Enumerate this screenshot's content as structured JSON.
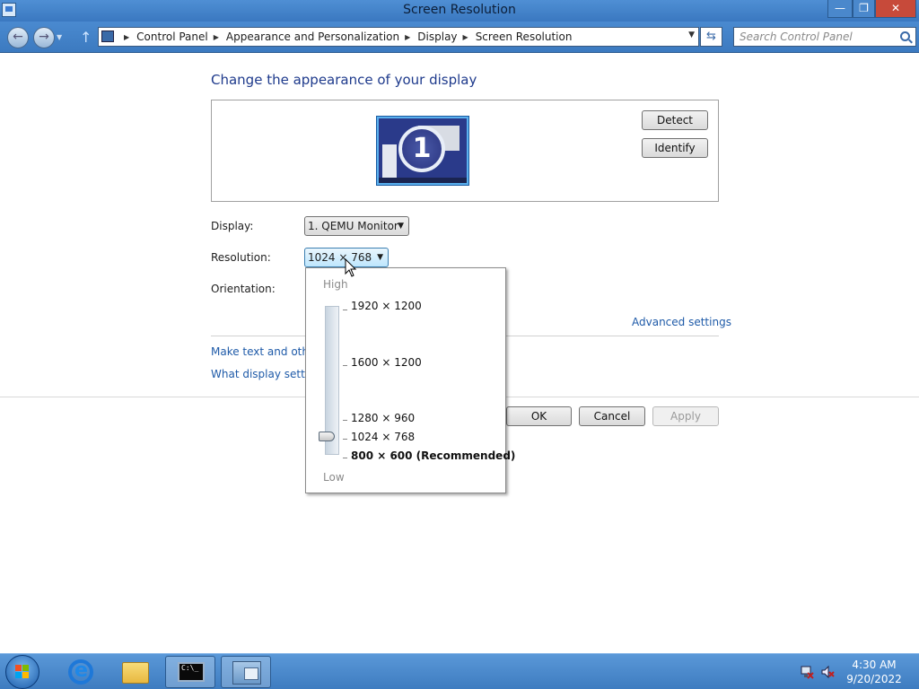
{
  "window": {
    "title": "Screen Resolution",
    "minimize_glyph": "—",
    "maximize_glyph": "❐",
    "close_glyph": "✕"
  },
  "nav": {
    "back_glyph": "←",
    "forward_glyph": "→",
    "up_glyph": "↑",
    "recent_glyph": "▼",
    "breadcrumb": [
      "Control Panel",
      "Appearance and Personalization",
      "Display",
      "Screen Resolution"
    ],
    "search_placeholder": "Search Control Panel",
    "refresh_glyph": "⇆"
  },
  "main": {
    "heading": "Change the appearance of your display",
    "monitor_number": "1",
    "detect_label": "Detect",
    "identify_label": "Identify",
    "display_label": "Display:",
    "display_value": "1. QEMU Monitor",
    "resolution_label": "Resolution:",
    "resolution_value": "1024 × 768",
    "orientation_label": "Orientation:",
    "advanced_link": "Advanced settings",
    "link_text_size": "Make text and other",
    "link_display_settings": "What display setting",
    "ok_label": "OK",
    "cancel_label": "Cancel",
    "apply_label": "Apply"
  },
  "resolution_dropdown": {
    "high_label": "High",
    "low_label": "Low",
    "options": [
      {
        "label": "1920 × 1200"
      },
      {
        "label": "1600 × 1200"
      },
      {
        "label": "1280 × 960"
      },
      {
        "label": "1024 × 768"
      },
      {
        "label": "800 × 600 (Recommended)"
      }
    ],
    "selected": "1024 × 768"
  },
  "taskbar": {
    "cmd_label": "C:\\_",
    "time": "4:30 AM",
    "date": "9/20/2022"
  },
  "colors": {
    "link": "#1e5aa8",
    "heading": "#1e3a8c",
    "titlebar": "#4f8fd4"
  }
}
